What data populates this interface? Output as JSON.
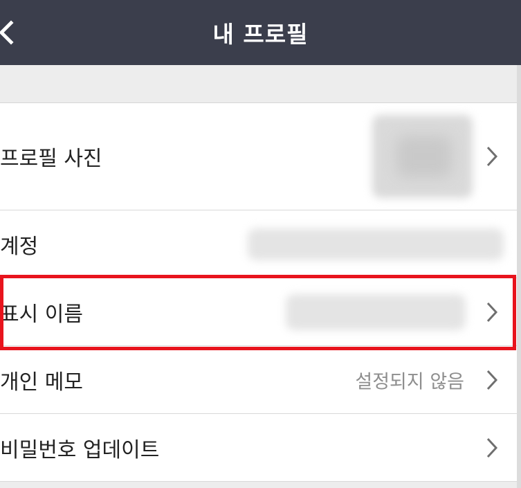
{
  "header": {
    "title": "내 프로필",
    "back_icon": "chevron-left-icon"
  },
  "colors": {
    "header_bg": "#3b3e4c",
    "highlight": "#e8141d",
    "value_text": "#8e8e8e"
  },
  "rows": [
    {
      "label": "프로필 사진",
      "value": "",
      "chevron": true
    },
    {
      "label": "계정",
      "value": "",
      "chevron": false
    },
    {
      "label": "표시 이름",
      "value": "",
      "chevron": true
    },
    {
      "label": "개인 메모",
      "value": "설정되지 않음",
      "chevron": true
    },
    {
      "label": "비밀번호 업데이트",
      "value": "",
      "chevron": true
    }
  ]
}
